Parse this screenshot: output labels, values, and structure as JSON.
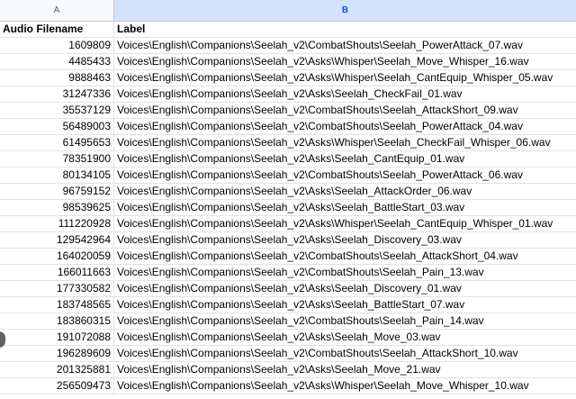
{
  "columns": {
    "a": "A",
    "b": "B"
  },
  "header": {
    "a": "Audio Filename",
    "b": "Label"
  },
  "rows": [
    {
      "id": "1609809",
      "label": "Voices\\English\\Companions\\Seelah_v2\\CombatShouts\\Seelah_PowerAttack_07.wav"
    },
    {
      "id": "4485433",
      "label": "Voices\\English\\Companions\\Seelah_v2\\Asks\\Whisper\\Seelah_Move_Whisper_16.wav"
    },
    {
      "id": "9888463",
      "label": "Voices\\English\\Companions\\Seelah_v2\\Asks\\Whisper\\Seelah_CantEquip_Whisper_05.wav"
    },
    {
      "id": "31247336",
      "label": "Voices\\English\\Companions\\Seelah_v2\\Asks\\Seelah_CheckFail_01.wav"
    },
    {
      "id": "35537129",
      "label": "Voices\\English\\Companions\\Seelah_v2\\CombatShouts\\Seelah_AttackShort_09.wav"
    },
    {
      "id": "56489003",
      "label": "Voices\\English\\Companions\\Seelah_v2\\CombatShouts\\Seelah_PowerAttack_04.wav"
    },
    {
      "id": "61495653",
      "label": "Voices\\English\\Companions\\Seelah_v2\\Asks\\Whisper\\Seelah_CheckFail_Whisper_06.wav"
    },
    {
      "id": "78351900",
      "label": "Voices\\English\\Companions\\Seelah_v2\\Asks\\Seelah_CantEquip_01.wav"
    },
    {
      "id": "80134105",
      "label": "Voices\\English\\Companions\\Seelah_v2\\CombatShouts\\Seelah_PowerAttack_06.wav"
    },
    {
      "id": "96759152",
      "label": "Voices\\English\\Companions\\Seelah_v2\\Asks\\Seelah_AttackOrder_06.wav"
    },
    {
      "id": "98539625",
      "label": "Voices\\English\\Companions\\Seelah_v2\\Asks\\Seelah_BattleStart_03.wav"
    },
    {
      "id": "111220928",
      "label": "Voices\\English\\Companions\\Seelah_v2\\Asks\\Whisper\\Seelah_CantEquip_Whisper_01.wav"
    },
    {
      "id": "129542964",
      "label": "Voices\\English\\Companions\\Seelah_v2\\Asks\\Seelah_Discovery_03.wav"
    },
    {
      "id": "164020059",
      "label": "Voices\\English\\Companions\\Seelah_v2\\CombatShouts\\Seelah_AttackShort_04.wav"
    },
    {
      "id": "166011663",
      "label": "Voices\\English\\Companions\\Seelah_v2\\CombatShouts\\Seelah_Pain_13.wav"
    },
    {
      "id": "177330582",
      "label": "Voices\\English\\Companions\\Seelah_v2\\Asks\\Seelah_Discovery_01.wav"
    },
    {
      "id": "183748565",
      "label": "Voices\\English\\Companions\\Seelah_v2\\Asks\\Seelah_BattleStart_07.wav"
    },
    {
      "id": "183860315",
      "label": "Voices\\English\\Companions\\Seelah_v2\\CombatShouts\\Seelah_Pain_14.wav"
    },
    {
      "id": "191072088",
      "label": "Voices\\English\\Companions\\Seelah_v2\\Asks\\Seelah_Move_03.wav"
    },
    {
      "id": "196289609",
      "label": "Voices\\English\\Companions\\Seelah_v2\\CombatShouts\\Seelah_AttackShort_10.wav"
    },
    {
      "id": "201325881",
      "label": "Voices\\English\\Companions\\Seelah_v2\\Asks\\Seelah_Move_21.wav"
    },
    {
      "id": "256509473",
      "label": "Voices\\English\\Companions\\Seelah_v2\\Asks\\Whisper\\Seelah_Move_Whisper_10.wav"
    }
  ]
}
